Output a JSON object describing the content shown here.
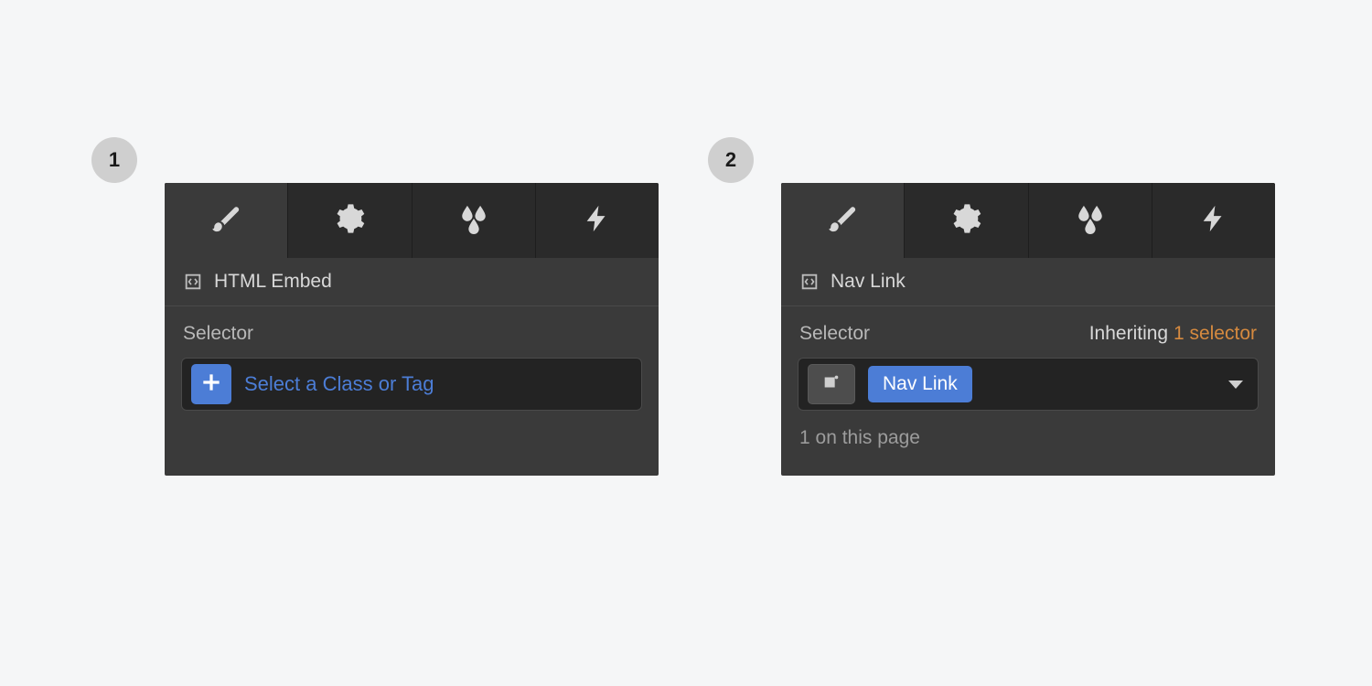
{
  "steps": {
    "one": "1",
    "two": "2"
  },
  "panel1": {
    "element_label": "HTML Embed",
    "selector_label": "Selector",
    "selector_placeholder": "Select a Class or Tag"
  },
  "panel2": {
    "element_label": "Nav Link",
    "selector_label": "Selector",
    "inheriting_label": "Inheriting",
    "inheriting_count": "1 selector",
    "class_chip": "Nav Link",
    "page_count": "1 on this page"
  },
  "icons": {
    "brush": "brush-icon",
    "gear": "gear-icon",
    "droplets": "droplets-icon",
    "bolt": "bolt-icon",
    "embed": "embed-icon",
    "plus": "plus-icon",
    "state": "state-icon",
    "caret": "caret-down-icon"
  }
}
